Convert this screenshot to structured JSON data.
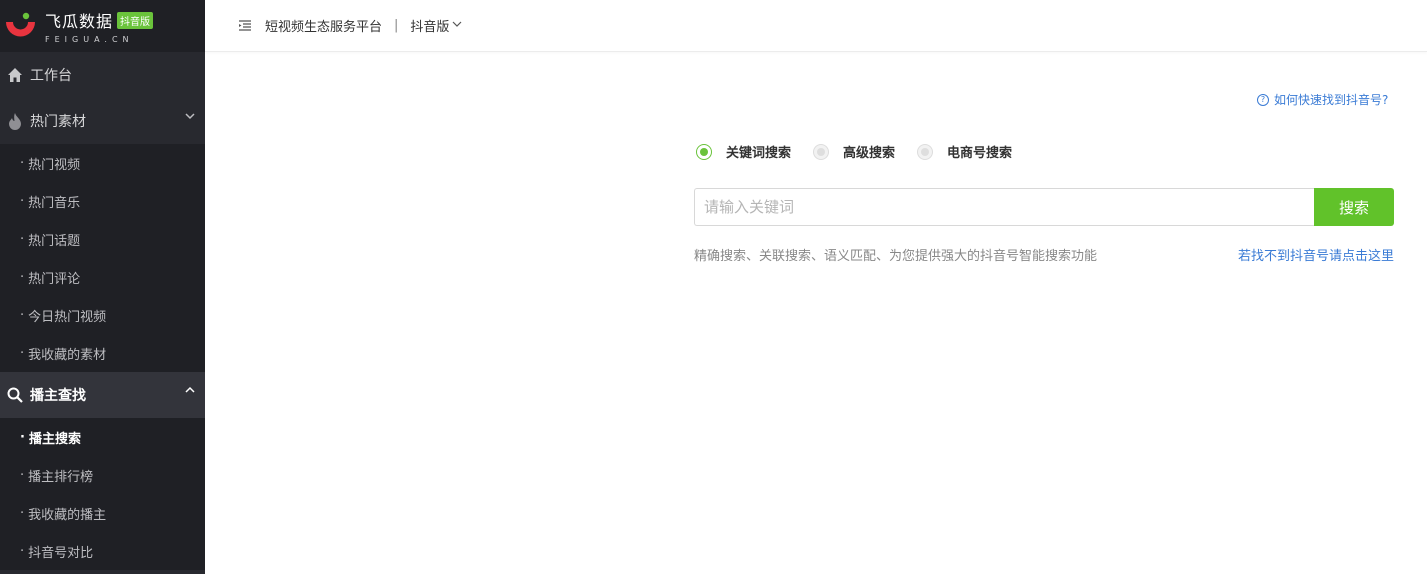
{
  "logo": {
    "title": "飞瓜数据",
    "badge": "抖音版",
    "subtitle": "FEIGUA.CN"
  },
  "sidebar": {
    "groups": [
      {
        "label": "工作台",
        "icon": "home-icon",
        "items": []
      },
      {
        "label": "热门素材",
        "icon": "fire-icon",
        "items": [
          "热门视频",
          "热门音乐",
          "热门话题",
          "热门评论",
          "今日热门视频",
          "我收藏的素材"
        ]
      },
      {
        "label": "播主查找",
        "icon": "search-icon",
        "items": [
          "播主搜索",
          "播主排行榜",
          "我收藏的播主",
          "抖音号对比"
        ]
      }
    ],
    "active_group": "播主查找",
    "active_item": "播主搜索"
  },
  "header": {
    "platform": "短视频生态服务平台",
    "separator": "|",
    "version": "抖音版"
  },
  "main": {
    "help_link": "如何快速找到抖音号?",
    "search_modes": [
      "关键词搜索",
      "高级搜索",
      "电商号搜索"
    ],
    "selected_mode": "关键词搜索",
    "search_placeholder": "请输入关键词",
    "search_value": "",
    "search_button": "搜索",
    "description": "精确搜索、关联搜索、语义匹配、为您提供强大的抖音号智能搜索功能",
    "not_found_link": "若找不到抖音号请点击这里"
  },
  "colors": {
    "accent_green": "#61c22a",
    "link_blue": "#3a7bd5",
    "sidebar_bg": "#28292f"
  }
}
